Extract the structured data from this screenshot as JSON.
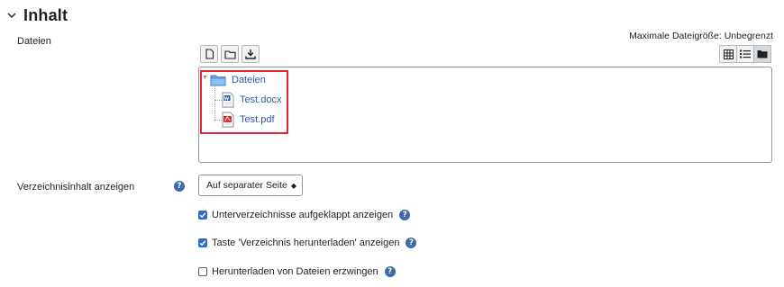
{
  "section": {
    "title": "Inhalt",
    "icon": "chevron-down-icon"
  },
  "files": {
    "label": "Dateien",
    "max_size_text": "Maximale Dateigröße: Unbegrenzt",
    "toolbar_left": [
      "new-file-icon",
      "new-folder-icon",
      "download-icon"
    ],
    "toolbar_right": [
      "grid-view-icon",
      "list-view-icon",
      "tree-view-icon"
    ],
    "active_view": "tree-view-icon",
    "tree": {
      "root": "Dateien",
      "children": [
        {
          "name": "Test.docx",
          "icon": "word-document-icon"
        },
        {
          "name": "Test.pdf",
          "icon": "pdf-document-icon"
        }
      ]
    },
    "highlight_color": "#e0242e"
  },
  "display": {
    "label": "Verzeichnisinhalt anzeigen",
    "select_value": "Auf separater Seite",
    "select_caret": "◆"
  },
  "options": [
    {
      "label": "Unterverzeichnisse aufgeklappt anzeigen",
      "checked": true
    },
    {
      "label": "Taste 'Verzeichnis herunterladen' anzeigen",
      "checked": true
    },
    {
      "label": "Herunterladen von Dateien erzwingen",
      "checked": false
    }
  ],
  "help_glyph": "?",
  "colors": {
    "accent": "#2f6bc8",
    "link": "#2c5aa0",
    "help": "#3d6aa8"
  }
}
